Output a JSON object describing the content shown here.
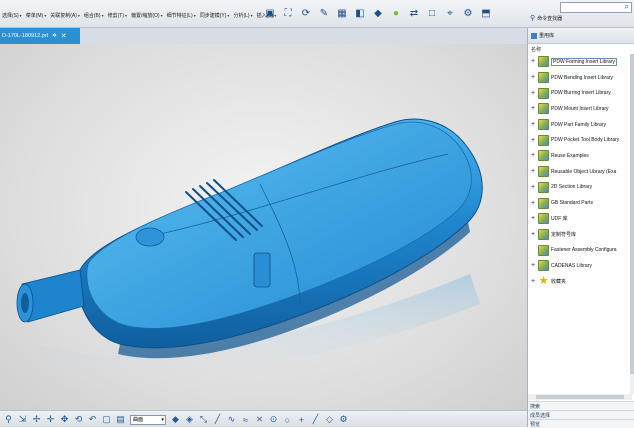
{
  "menu": {
    "items": [
      {
        "label": "选择(S)"
      },
      {
        "label": "菜单(M)"
      },
      {
        "label": "关联复制(A)"
      },
      {
        "label": "组合(B)"
      },
      {
        "label": "修剪(T)"
      },
      {
        "label": "偏置/缩放(O)"
      },
      {
        "label": "细节特征(L)"
      },
      {
        "label": "同步建模(Y)"
      },
      {
        "label": "分析(L)"
      },
      {
        "label": "插入(S)"
      }
    ],
    "command_finder": "命令查找器"
  },
  "toolbar_icons": [
    "square-icon",
    "fit-icon",
    "refresh-icon",
    "brush-icon",
    "grid-icon",
    "layers-icon",
    "cube-icon",
    "sphere-icon",
    "arrow-icon",
    "box-icon",
    "coord-icon",
    "gear-icon",
    "view-icon"
  ],
  "file_tab": {
    "label": "D-170L-180912.prt"
  },
  "panel": {
    "title": "重用库",
    "subtitle": "名称",
    "libraries": [
      {
        "label": "PDW Forming Insert Library"
      },
      {
        "label": "PDW Bending Insert Library"
      },
      {
        "label": "PDW Burring Insert Library"
      },
      {
        "label": "PDW Mount Insert Library"
      },
      {
        "label": "PDW Part Family Library"
      },
      {
        "label": "PDW Pocket Tool Body Library"
      },
      {
        "label": "Reuse Examples"
      },
      {
        "label": "Reusable Object Library (Exa"
      },
      {
        "label": "2D Section Library"
      },
      {
        "label": "GB Standard Parts"
      },
      {
        "label": "UDF 库"
      },
      {
        "label": "定制符号库"
      },
      {
        "label": "Fastener Assembly Configura"
      },
      {
        "label": "CADENAS Library"
      },
      {
        "label": "收藏夹"
      }
    ],
    "footer": [
      "搜索",
      "成员选择",
      "预览"
    ]
  },
  "bottom": {
    "select_value": "曲面"
  },
  "colors": {
    "model": "#2a8ed6",
    "accent": "#2b8fd1"
  }
}
